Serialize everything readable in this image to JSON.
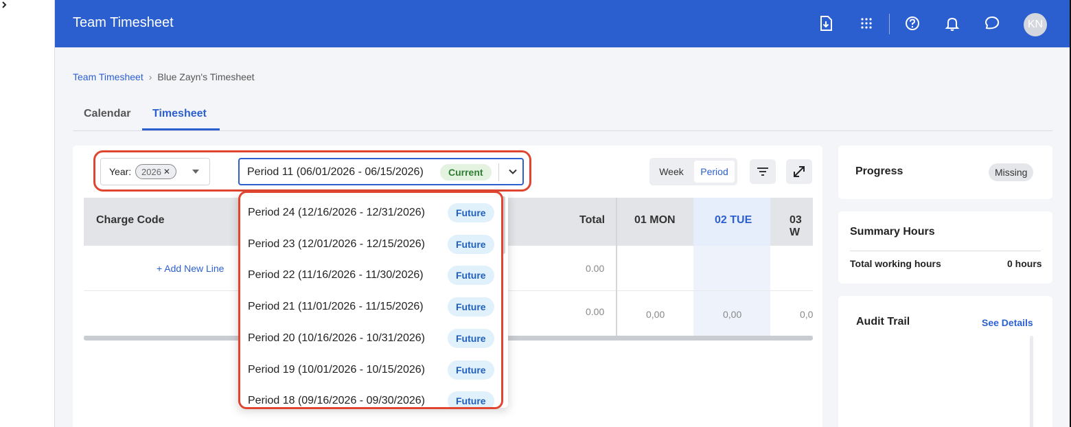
{
  "app": {
    "title": "Team Timesheet",
    "avatar_initials": "KN",
    "accent": "#2b5fd0"
  },
  "breadcrumb": {
    "parent": "Team Timesheet",
    "separator": "›",
    "current": "Blue Zayn's Timesheet"
  },
  "tabs": [
    {
      "label": "Calendar",
      "active": false
    },
    {
      "label": "Timesheet",
      "active": true
    }
  ],
  "filters": {
    "year_label": "Year:",
    "year_value": "2026",
    "period_selected": "Period 11 (06/01/2026 - 06/15/2026)",
    "period_badge": "Current"
  },
  "view_toggle": {
    "week": "Week",
    "period": "Period",
    "selected": "Period"
  },
  "table": {
    "headers": {
      "charge_code": "Charge Code",
      "total": "Total",
      "days": [
        "01 MON",
        "02 TUE",
        "03 W"
      ]
    },
    "add_line": "+ Add New Line",
    "row1_total": "0.00",
    "row2": {
      "total": "0.00",
      "mon": "0,00",
      "tue": "0,00",
      "wed": "0,0"
    }
  },
  "period_options": [
    {
      "label": "Period 24 (12/16/2026 - 12/31/2026)",
      "badge": "Future"
    },
    {
      "label": "Period 23 (12/01/2026 - 12/15/2026)",
      "badge": "Future"
    },
    {
      "label": "Period 22 (11/16/2026 - 11/30/2026)",
      "badge": "Future"
    },
    {
      "label": "Period 21 (11/01/2026 - 11/15/2026)",
      "badge": "Future"
    },
    {
      "label": "Period 20 (10/16/2026 - 10/31/2026)",
      "badge": "Future"
    },
    {
      "label": "Period 19 (10/01/2026 - 10/15/2026)",
      "badge": "Future"
    },
    {
      "label": "Period 18 (09/16/2026 - 09/30/2026)",
      "badge": "Future"
    }
  ],
  "progress": {
    "title": "Progress",
    "status": "Missing"
  },
  "summary": {
    "title": "Summary Hours",
    "row_label": "Total working hours",
    "row_value": "0 hours"
  },
  "audit": {
    "title": "Audit Trail",
    "link": "See Details"
  },
  "icons": {
    "rail": [
      "logo-cube-icon",
      "pie-chart-icon",
      "calendar-grid-icon",
      "contact-card-icon",
      "chart-add-icon",
      "calendar-list-icon"
    ],
    "header": [
      "export-file-icon",
      "apps-grid-icon",
      "help-icon",
      "bell-icon",
      "chat-icon"
    ]
  }
}
